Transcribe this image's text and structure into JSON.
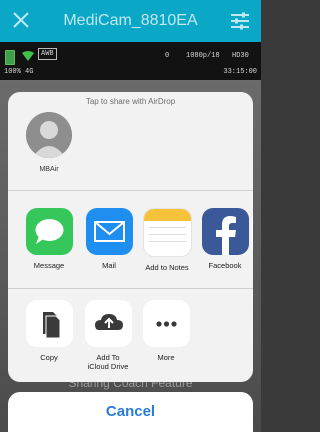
{
  "header": {
    "title": "MediCam_8810EA"
  },
  "status": {
    "battery": "100%",
    "network": "4G",
    "awb": "AWB",
    "zero": "0",
    "resolution": "1080p/18",
    "quality": "HD30",
    "time": "33:15:00"
  },
  "background_text": "Sharing Coach Feature",
  "share_sheet": {
    "airdrop_hint": "Tap to share with AirDrop",
    "airdrop_device": "MBAir",
    "apps": [
      {
        "label": "Message"
      },
      {
        "label": "Mail"
      },
      {
        "label": "Add to Notes"
      },
      {
        "label": "Facebook"
      }
    ],
    "actions": [
      {
        "label": "Copy"
      },
      {
        "label": "Add To\niCloud Drive"
      },
      {
        "label": "More"
      }
    ],
    "cancel_label": "Cancel"
  },
  "colors": {
    "header_bg": "#0ba7c7",
    "messages_green": "#35c759",
    "mail_blue": "#1f8ef1",
    "facebook_blue": "#3b5998",
    "cancel_blue": "#2a7bd9"
  }
}
